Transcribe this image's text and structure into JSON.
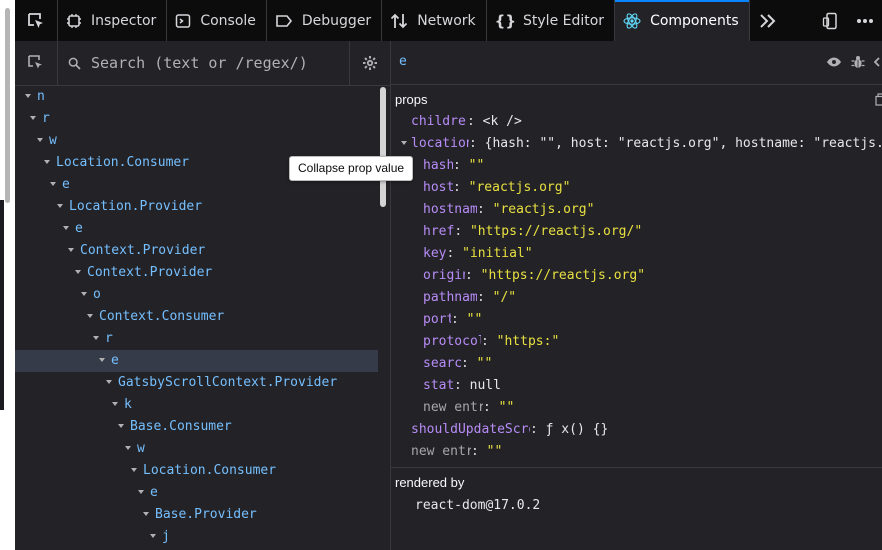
{
  "toolbar": {
    "tabs": [
      {
        "label": "Inspector"
      },
      {
        "label": "Console"
      },
      {
        "label": "Debugger"
      },
      {
        "label": "Network"
      },
      {
        "label": "Style Editor"
      },
      {
        "label": "Components"
      }
    ],
    "active_tab": "Components"
  },
  "search": {
    "placeholder": "Search (text or /regex/)"
  },
  "tree": {
    "nodes": [
      {
        "label": "n",
        "depth": 0
      },
      {
        "label": "r",
        "depth": 1
      },
      {
        "label": "w",
        "depth": 2
      },
      {
        "label": "Location.Consumer",
        "depth": 3
      },
      {
        "label": "e",
        "depth": 4
      },
      {
        "label": "Location.Provider",
        "depth": 5
      },
      {
        "label": "e",
        "depth": 6
      },
      {
        "label": "Context.Provider",
        "depth": 7
      },
      {
        "label": "Context.Provider",
        "depth": 8
      },
      {
        "label": "o",
        "depth": 9
      },
      {
        "label": "Context.Consumer",
        "depth": 10
      },
      {
        "label": "r",
        "depth": 11
      },
      {
        "label": "e",
        "depth": 12,
        "selected": true
      },
      {
        "label": "GatsbyScrollContext.Provider",
        "depth": 13
      },
      {
        "label": "k",
        "depth": 14
      },
      {
        "label": "Base.Consumer",
        "depth": 15
      },
      {
        "label": "w",
        "depth": 16
      },
      {
        "label": "Location.Consumer",
        "depth": 17
      },
      {
        "label": "e",
        "depth": 18
      },
      {
        "label": "Base.Provider",
        "depth": 19
      },
      {
        "label": "j",
        "depth": 20
      }
    ]
  },
  "details": {
    "component_name": "e",
    "props_title": "props",
    "props": [
      {
        "key": "children",
        "value": "<k />",
        "type": "plain",
        "indent": 0
      },
      {
        "key": "location",
        "value": "{hash: \"\", host: \"reactjs.org\", hostname: \"reactjs.…",
        "type": "plain",
        "indent": 0,
        "expanded": true
      },
      {
        "key": "hash",
        "value": "\"\"",
        "type": "str",
        "indent": 1
      },
      {
        "key": "host",
        "value": "\"reactjs.org\"",
        "type": "str",
        "indent": 1
      },
      {
        "key": "hostname",
        "value": "\"reactjs.org\"",
        "type": "str",
        "indent": 1
      },
      {
        "key": "href",
        "value": "\"https://reactjs.org/\"",
        "type": "str",
        "indent": 1
      },
      {
        "key": "key",
        "value": "\"initial\"",
        "type": "str",
        "indent": 1
      },
      {
        "key": "origin",
        "value": "\"https://reactjs.org\"",
        "type": "str",
        "indent": 1
      },
      {
        "key": "pathname",
        "value": "\"/\"",
        "type": "str",
        "indent": 1
      },
      {
        "key": "port",
        "value": "\"\"",
        "type": "str",
        "indent": 1
      },
      {
        "key": "protocol",
        "value": "\"https:\"",
        "type": "str",
        "indent": 1
      },
      {
        "key": "search",
        "value": "\"\"",
        "type": "str",
        "indent": 1
      },
      {
        "key": "state",
        "value": "null",
        "type": "null",
        "indent": 1
      },
      {
        "key": "new entry",
        "value": "\"\"",
        "type": "str",
        "indent": 1,
        "dim": true
      },
      {
        "key": "shouldUpdateScroll",
        "value": "ƒ x() {}",
        "type": "plain",
        "indent": 0
      },
      {
        "key": "new entry",
        "value": "\"\"",
        "type": "str",
        "indent": 0,
        "dim": true
      }
    ],
    "rendered_by_title": "rendered by",
    "rendered_by": "react-dom@17.0.2"
  },
  "tooltip": {
    "text": "Collapse prop value"
  },
  "colors": {
    "accent": "#0a84ff",
    "component": "#75bfff",
    "prop_key": "#b78cf7",
    "string": "#e8e040"
  }
}
